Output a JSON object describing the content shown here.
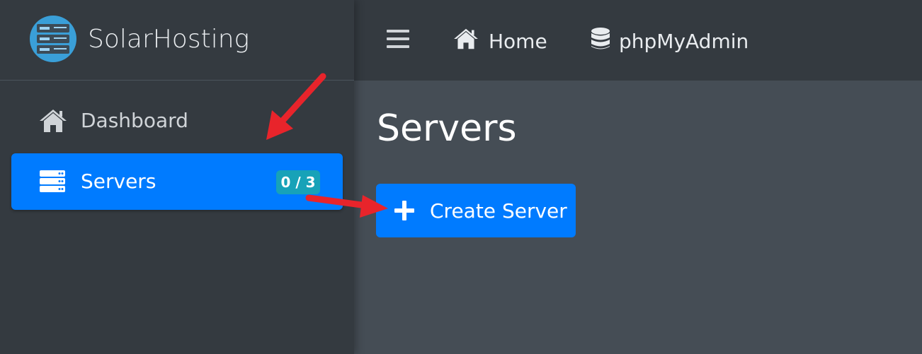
{
  "brand": {
    "name": "SolarHosting",
    "logo_icon": "server-rack-icon"
  },
  "sidebar": {
    "items": [
      {
        "label": "Dashboard",
        "icon": "home-icon",
        "active": false
      },
      {
        "label": "Servers",
        "icon": "servers-icon",
        "active": true,
        "badge": "0 / 3"
      }
    ]
  },
  "topbar": {
    "menu_icon": "hamburger-icon",
    "links": [
      {
        "label": "Home",
        "icon": "home-icon"
      },
      {
        "label": "phpMyAdmin",
        "icon": "database-icon"
      }
    ]
  },
  "main": {
    "title": "Servers",
    "create_button": {
      "label": "Create Server",
      "icon": "plus-icon"
    }
  },
  "colors": {
    "sidebar_bg": "#343a40",
    "content_bg": "#454d55",
    "primary": "#007bff",
    "badge": "#17a2b8",
    "annotation_arrow": "#e8242b"
  }
}
